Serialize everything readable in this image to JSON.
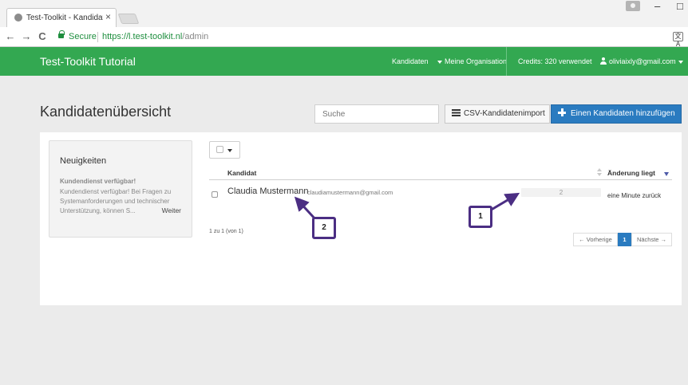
{
  "browser": {
    "tab_title": "Test-Toolkit - Kandidaten",
    "tab_close": "×",
    "back": "←",
    "forward": "→",
    "reload": "C",
    "secure_label": "Secure",
    "url_host": "https://l.test-toolkit.nl",
    "url_path": "/admin",
    "translate": "文A",
    "minimize": "–",
    "maximize": "□"
  },
  "navbar": {
    "brand": "Test-Toolkit Tutorial",
    "kandidaten": "Kandidaten",
    "organisation": "Meine Organisation",
    "credits": "Credits: 320 verwendet",
    "user_email": "oliviaixly@gmail.com",
    "bg_color": "#33a851"
  },
  "header": {
    "title": "Kandidatenübersicht",
    "search_placeholder": "Suche",
    "import_button": "CSV-Kandidatenimport",
    "add_button": "Einen Kandidaten hinzufügen"
  },
  "news": {
    "title": "Neuigkeiten",
    "headline": "Kundendienst verfügbar!",
    "body": "Kundendienst verfügbar! Bei Fragen zu Systemanforderungen und technischer Unterstützung, können S...",
    "more": "Weiter"
  },
  "table": {
    "col_candidate": "Kandidat",
    "col_changed": "Änderung liegt",
    "rows": [
      {
        "name": "Claudia Mustermann",
        "email": "claudiamustermann@gmail.com",
        "progress": "2",
        "changed": "eine Minute zurück"
      }
    ],
    "page_info": "1 zu 1 (von 1)"
  },
  "pagination": {
    "prev": "← Vorherige",
    "current": "1",
    "next": "Nächste →"
  },
  "annotations": {
    "badge1": "1",
    "badge2": "2",
    "color": "#4b2e83"
  }
}
